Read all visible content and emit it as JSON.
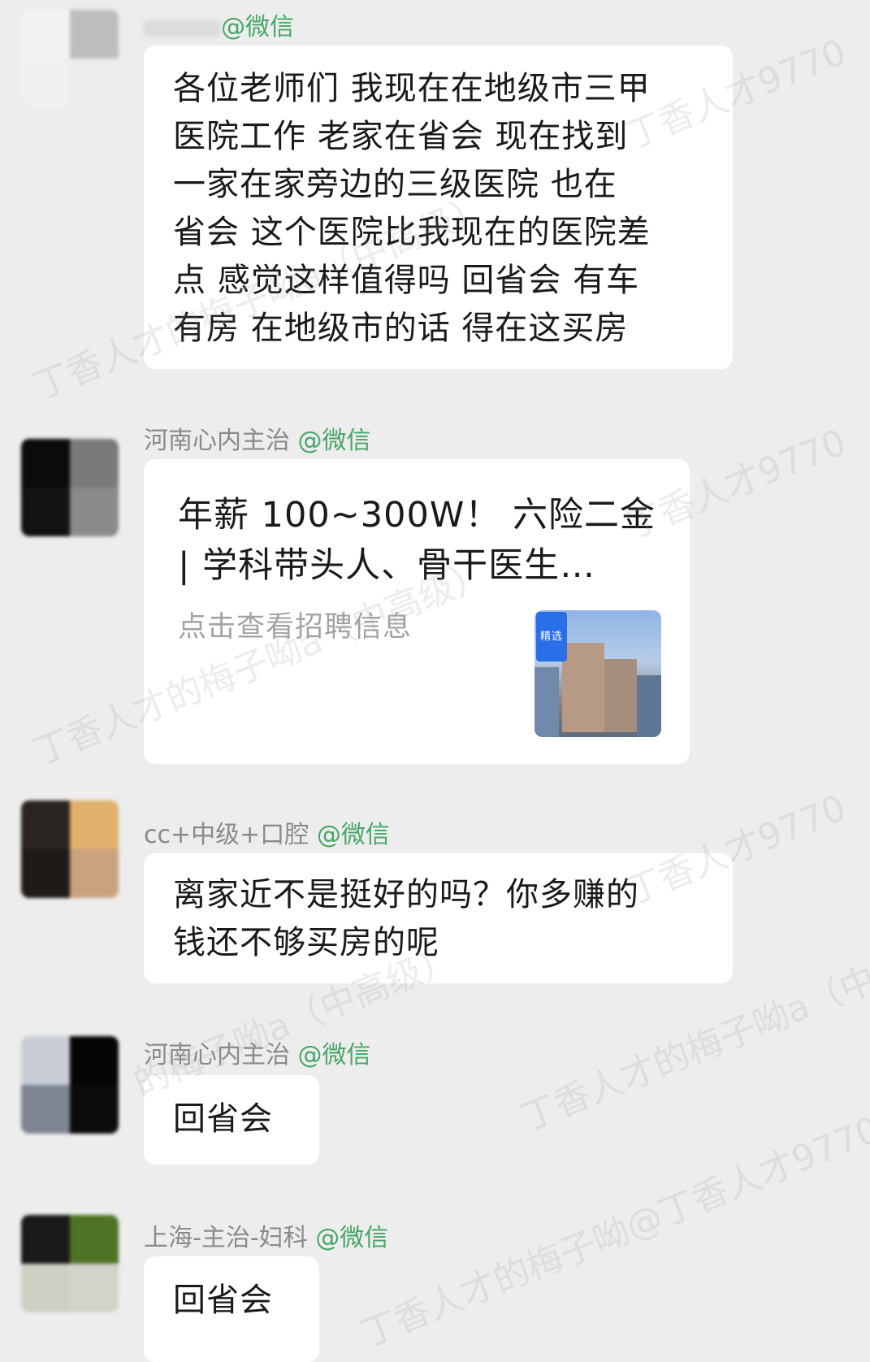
{
  "messages": [
    {
      "name": "",
      "tag": "@微信",
      "lines": [
        "各位老师们 我现在在地级市三甲",
        "医院工作 老家在省会 现在找到",
        "一家在家旁边的三级医院  也在",
        "省会 这个医院比我现在的医院差",
        "点 感觉这样值得吗  回省会 有车",
        "有房 在地级市的话 得在这买房"
      ]
    },
    {
      "name": "河南心内主治",
      "tag": "@微信",
      "card": {
        "title_lines": [
          "年薪 100~300W！ 六险二金",
          "| 学科带头人、骨干医生…"
        ],
        "subtitle": "点击查看招聘信息",
        "thumb_badge": "精选"
      }
    },
    {
      "name": "cc+中级+口腔",
      "tag": "@微信",
      "lines": [
        "离家近不是挺好的吗？你多赚的",
        "钱还不够买房的呢"
      ]
    },
    {
      "name": "河南心内主治",
      "tag": "@微信",
      "lines": [
        "回省会"
      ]
    },
    {
      "name": "上海-主治-妇科",
      "tag": "@微信",
      "lines": [
        "回省会"
      ]
    }
  ],
  "watermarks": {
    "line_a": "丁香人才9770",
    "line_b": "丁香人才的梅子呦a（中高级）",
    "line_c": "的梅子呦a（中高级）",
    "line_d": "丁香人才的梅子呦@丁香人才9770"
  },
  "colors": {
    "background": "#ededed",
    "bubble": "#ffffff",
    "wechat_tag": "#47a667",
    "sender_name": "#8a8a8a"
  }
}
